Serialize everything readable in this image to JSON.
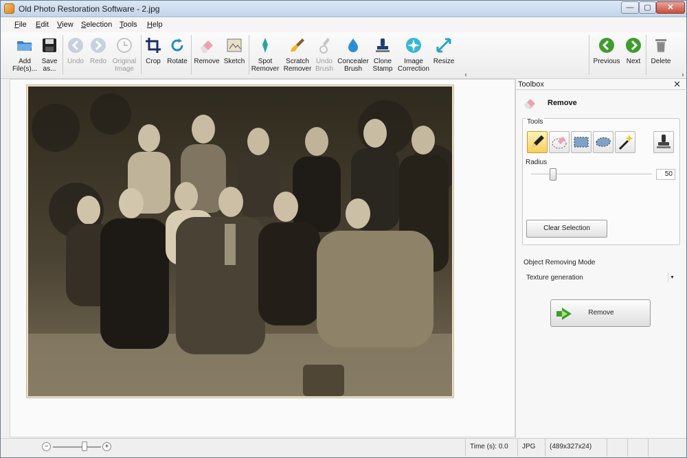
{
  "window": {
    "title": "Old Photo Restoration Software - 2.jpg",
    "min": "—",
    "max": "▢",
    "close": "✕"
  },
  "menu": [
    "File",
    "Edit",
    "View",
    "Selection",
    "Tools",
    "Help"
  ],
  "toolbar": {
    "add_files": "Add\nFile(s)...",
    "save_as": "Save\nas...",
    "undo": "Undo",
    "redo": "Redo",
    "original_image": "Original\nImage",
    "crop": "Crop",
    "rotate": "Rotate",
    "remove": "Remove",
    "sketch": "Sketch",
    "spot_remover": "Spot\nRemover",
    "scratch_remover": "Scratch\nRemover",
    "undo_brush": "Undo\nBrush",
    "concealer_brush": "Concealer\nBrush",
    "clone_stamp": "Clone\nStamp",
    "image_correction": "Image\nCorrection",
    "resize": "Resize",
    "previous": "Previous",
    "next": "Next",
    "delete": "Delete"
  },
  "toolbox": {
    "title": "Toolbox",
    "close": "✕",
    "section": "Remove",
    "tools_label": "Tools",
    "radius_label": "Radius",
    "radius_value": "50",
    "radius_fraction": 0.18,
    "clear_selection": "Clear Selection",
    "mode_label": "Object Removing Mode",
    "mode_value": "Texture generation",
    "mode_arrow": "▾",
    "remove_button": "Remove"
  },
  "status": {
    "zoom_minus": "−",
    "zoom_plus": "+",
    "time": "Time (s): 0.0",
    "format": "JPG",
    "dimensions": "(489x327x24)"
  },
  "colors": {
    "accent_green": "#3f9d2f",
    "photo_sepia": "#4a4232",
    "toolbar_bg": "#f5f5f5"
  }
}
